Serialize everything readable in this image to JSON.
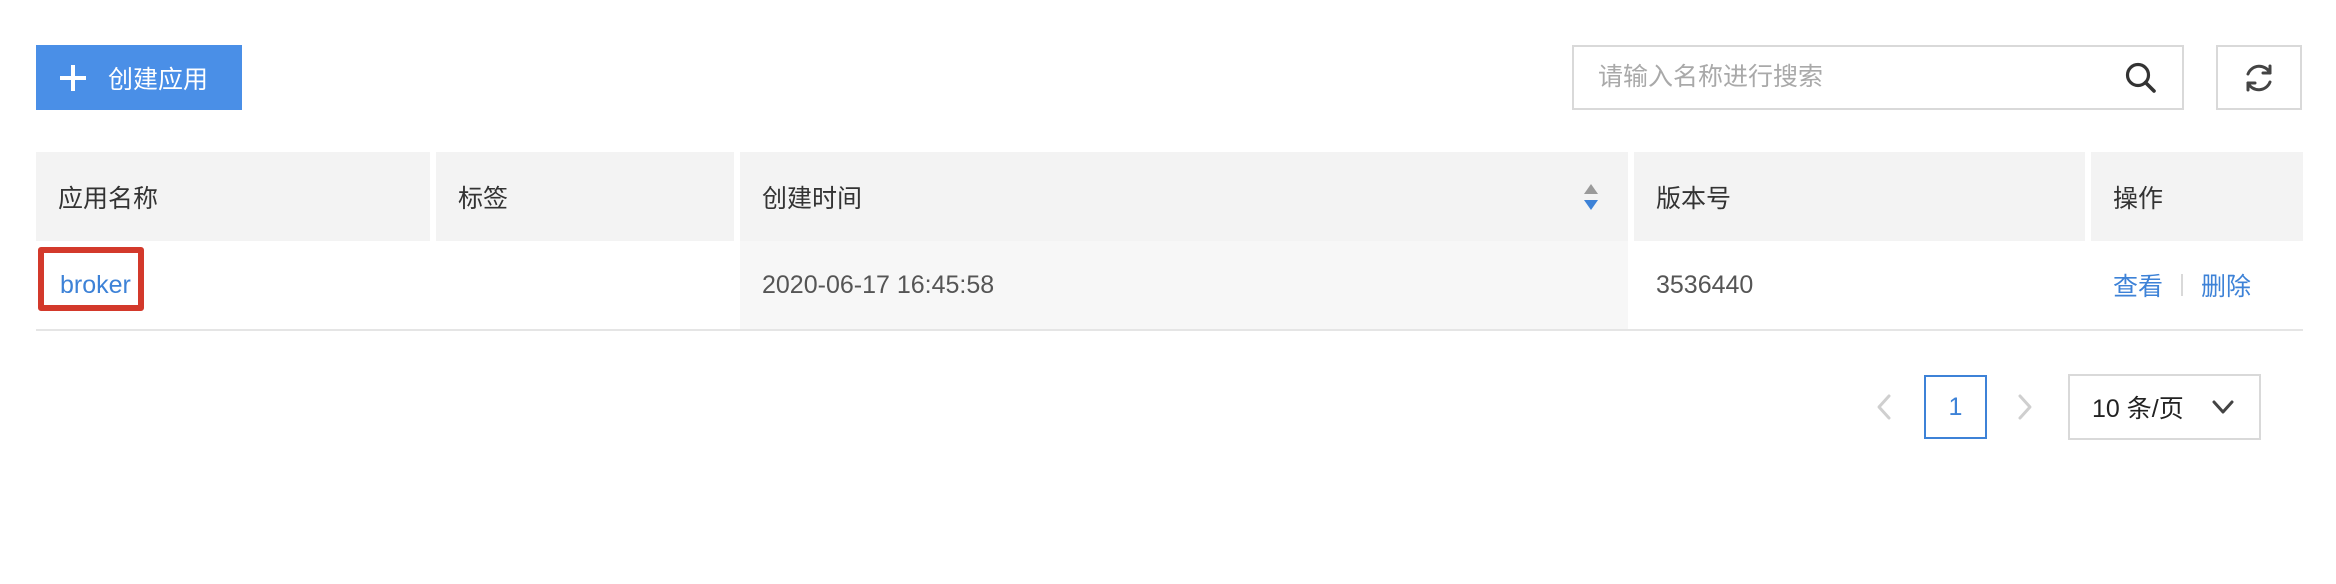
{
  "toolbar": {
    "create_label": "创建应用",
    "search": {
      "placeholder": "请输入名称进行搜索",
      "value": ""
    },
    "icons": {
      "create": "plus-icon",
      "search": "search-icon",
      "refresh": "refresh-icon"
    }
  },
  "table": {
    "columns": [
      "应用名称",
      "标签",
      "创建时间",
      "版本号",
      "操作"
    ],
    "sort_column": "创建时间",
    "rows": [
      {
        "name": "broker",
        "tags": "",
        "created": "2020-06-17 16:45:58",
        "version": "3536440",
        "actions": [
          "查看",
          "删除"
        ],
        "highlighted": true
      }
    ]
  },
  "pagination": {
    "current_page": "1",
    "page_size": "10 条/页"
  },
  "colors": {
    "accent": "#4a8fe7",
    "link": "#3d82d7",
    "highlight": "#d3392b"
  }
}
